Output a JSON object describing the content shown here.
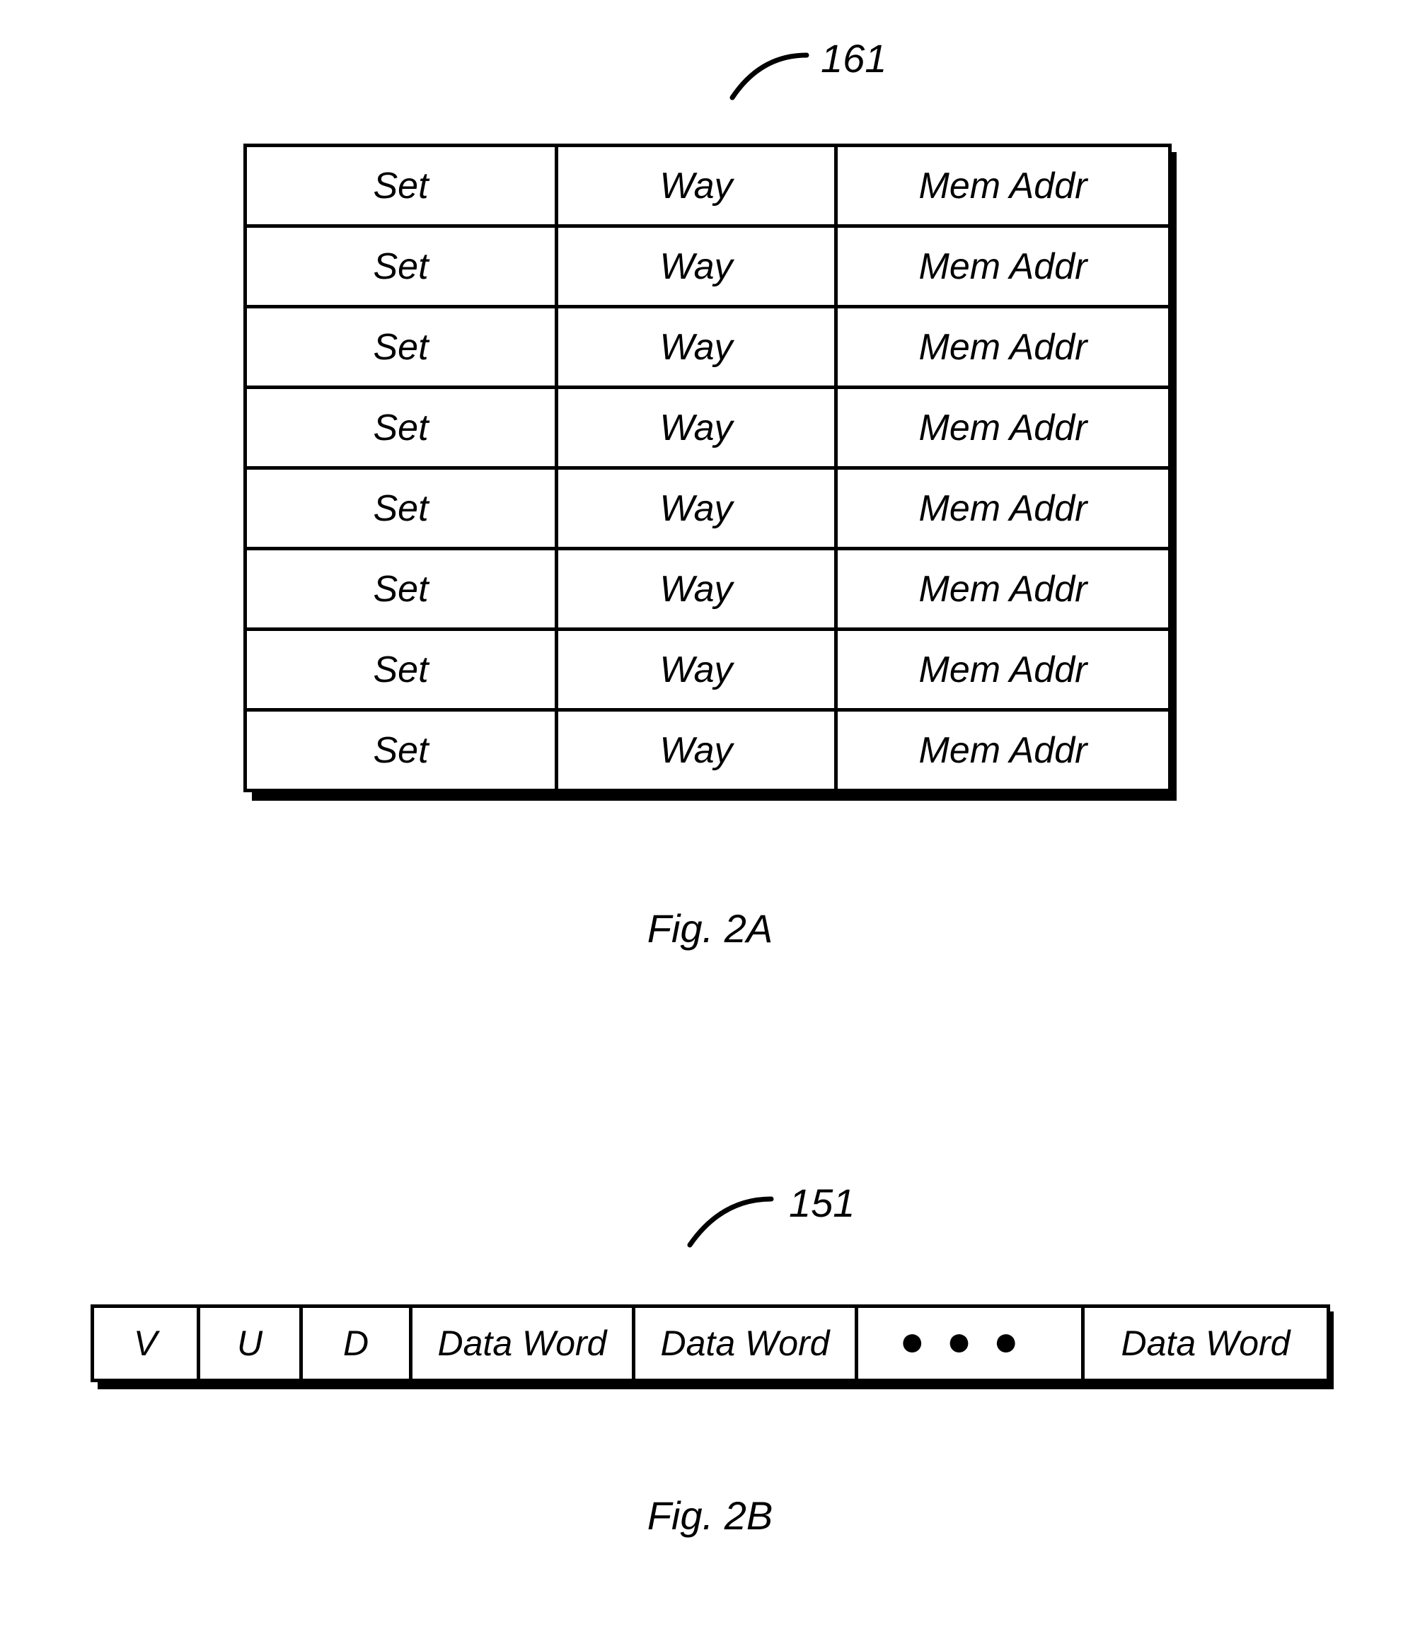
{
  "figA": {
    "ref": "161",
    "rows": [
      {
        "set": "Set",
        "way": "Way",
        "addr": "Mem Addr"
      },
      {
        "set": "Set",
        "way": "Way",
        "addr": "Mem Addr"
      },
      {
        "set": "Set",
        "way": "Way",
        "addr": "Mem Addr"
      },
      {
        "set": "Set",
        "way": "Way",
        "addr": "Mem Addr"
      },
      {
        "set": "Set",
        "way": "Way",
        "addr": "Mem Addr"
      },
      {
        "set": "Set",
        "way": "Way",
        "addr": "Mem Addr"
      },
      {
        "set": "Set",
        "way": "Way",
        "addr": "Mem Addr"
      },
      {
        "set": "Set",
        "way": "Way",
        "addr": "Mem Addr"
      }
    ],
    "caption": "Fig. 2A"
  },
  "figB": {
    "ref": "151",
    "cells": {
      "v": "V",
      "u": "U",
      "d": "D",
      "w1": "Data Word",
      "w2": "Data Word",
      "dots": "●●●",
      "w3": "Data Word"
    },
    "caption": "Fig. 2B"
  },
  "chart_data": [
    {
      "type": "table",
      "title": "Fig. 2A — reference 161",
      "columns": [
        "Set",
        "Way",
        "Mem Addr"
      ],
      "row_count": 8,
      "rows": [
        [
          "Set",
          "Way",
          "Mem Addr"
        ],
        [
          "Set",
          "Way",
          "Mem Addr"
        ],
        [
          "Set",
          "Way",
          "Mem Addr"
        ],
        [
          "Set",
          "Way",
          "Mem Addr"
        ],
        [
          "Set",
          "Way",
          "Mem Addr"
        ],
        [
          "Set",
          "Way",
          "Mem Addr"
        ],
        [
          "Set",
          "Way",
          "Mem Addr"
        ],
        [
          "Set",
          "Way",
          "Mem Addr"
        ]
      ]
    },
    {
      "type": "table",
      "title": "Fig. 2B — reference 151",
      "columns": [
        "V",
        "U",
        "D",
        "Data Word",
        "Data Word",
        "…",
        "Data Word"
      ],
      "row_count": 1,
      "rows": [
        [
          "V",
          "U",
          "D",
          "Data Word",
          "Data Word",
          "…",
          "Data Word"
        ]
      ]
    }
  ]
}
